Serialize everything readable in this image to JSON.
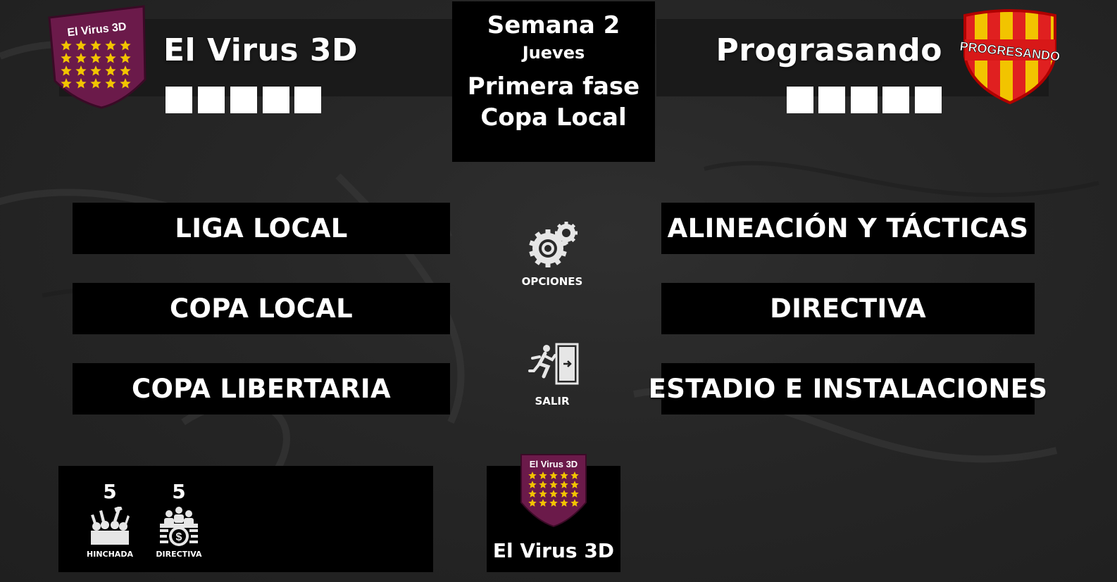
{
  "home_team": {
    "name": "El Virus 3D",
    "crest_text": "El Virus 3D",
    "crest_color": "#6b1a4a",
    "star_color": "#f2c400"
  },
  "away_team": {
    "name": "Prograsando",
    "crest_text": "PROGRESANDO",
    "crest_colors": [
      "#e02020",
      "#f2c400"
    ]
  },
  "match_info": {
    "week": "Semana 2",
    "day": "Jueves",
    "phase": "Primera fase",
    "competition": "Copa Local"
  },
  "left_menu": [
    {
      "label": "LIGA LOCAL"
    },
    {
      "label": "COPA LOCAL"
    },
    {
      "label": "COPA LIBERTARIA"
    }
  ],
  "right_menu": [
    {
      "label": "ALINEACIÓN Y TÁCTICAS"
    },
    {
      "label": "DIRECTIVA"
    },
    {
      "label": "ESTADIO E INSTALACIONES"
    }
  ],
  "center_actions": {
    "options_label": "OPCIONES",
    "options_icon": "gears-icon",
    "exit_label": "SALIR",
    "exit_icon": "exit-door-icon"
  },
  "stats": {
    "fans": {
      "value": "5",
      "label": "HINCHADA",
      "icon": "crowd-icon"
    },
    "board": {
      "value": "5",
      "label": "DIRECTIVA",
      "icon": "board-money-icon"
    }
  },
  "club_panel": {
    "name": "El Virus 3D",
    "crest_text": "El Virus 3D"
  }
}
